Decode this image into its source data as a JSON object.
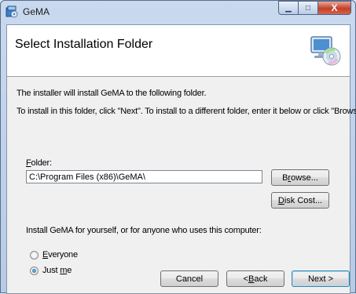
{
  "window": {
    "title": "GeMA",
    "minimize_glyph": "▁",
    "maximize_glyph": "□",
    "close_glyph": "X",
    "app_icon": "installer-icon",
    "close_color": "#c3402a"
  },
  "banner": {
    "title": "Select Installation Folder",
    "icon": "computer-cd-icon"
  },
  "body": {
    "intro": "The installer will install GeMA to the following folder.",
    "instructions": "To install in this folder, click \"Next\". To install to a different folder, enter it below or click \"Browse\".",
    "folder_label_first": "F",
    "folder_label_rest": "older:",
    "folder_value": "C:\\Program Files (x86)\\GeMA\\",
    "browse_pre": "B",
    "browse_u": "r",
    "browse_post": "owse...",
    "disk_u": "D",
    "disk_post": "isk Cost...",
    "install_for": "Install GeMA for yourself, or for anyone who uses this computer:",
    "everyone_u": "E",
    "everyone_post": "veryone",
    "justme_pre": "Just ",
    "justme_u": "m",
    "justme_post": "e",
    "selected_option": "Just me"
  },
  "footer": {
    "cancel_label": "Cancel",
    "back_pre": "< ",
    "back_u": "B",
    "back_post": "ack",
    "next_label": "Next >"
  }
}
